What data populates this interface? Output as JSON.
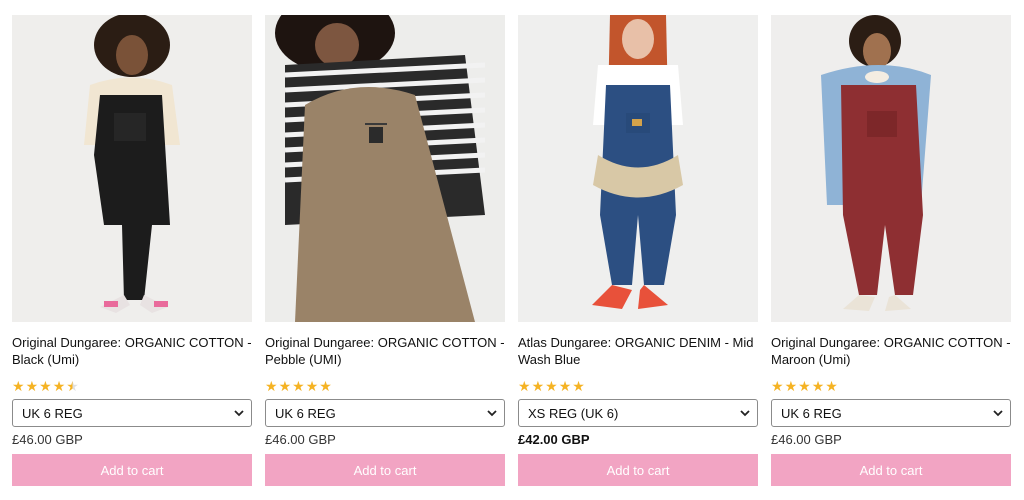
{
  "products": [
    {
      "title": "Original Dungaree: ORGANIC COTTON - Black (Umi)",
      "rating": 4.5,
      "size": "UK 6 REG",
      "price": "£46.00 GBP",
      "price_bold": false,
      "add_to_cart": "Add to cart",
      "garment_color": "#1c1c1c",
      "top_color": "#f1e6d2"
    },
    {
      "title": "Original Dungaree: ORGANIC COTTON - Pebble (UMI)",
      "rating": 5,
      "size": "UK 6 REG",
      "price": "£46.00 GBP",
      "price_bold": false,
      "add_to_cart": "Add to cart",
      "garment_color": "#9a8368",
      "top_color": "#2a2a2a"
    },
    {
      "title": "Atlas Dungaree: ORGANIC DENIM - Mid Wash Blue",
      "rating": 5,
      "size": "XS REG (UK 6)",
      "price": "£42.00 GBP",
      "price_bold": true,
      "add_to_cart": "Add to cart",
      "garment_color": "#2c4f82",
      "top_color": "#ffffff"
    },
    {
      "title": "Original Dungaree: ORGANIC COTTON - Maroon (Umi)",
      "rating": 5,
      "size": "UK 6 REG",
      "price": "£46.00 GBP",
      "price_bold": false,
      "add_to_cart": "Add to cart",
      "garment_color": "#8e2f32",
      "top_color": "#8fb3d6"
    }
  ],
  "colors": {
    "star": "#f5b324",
    "button": "#f2a4c3",
    "button_text": "#ffffff"
  }
}
